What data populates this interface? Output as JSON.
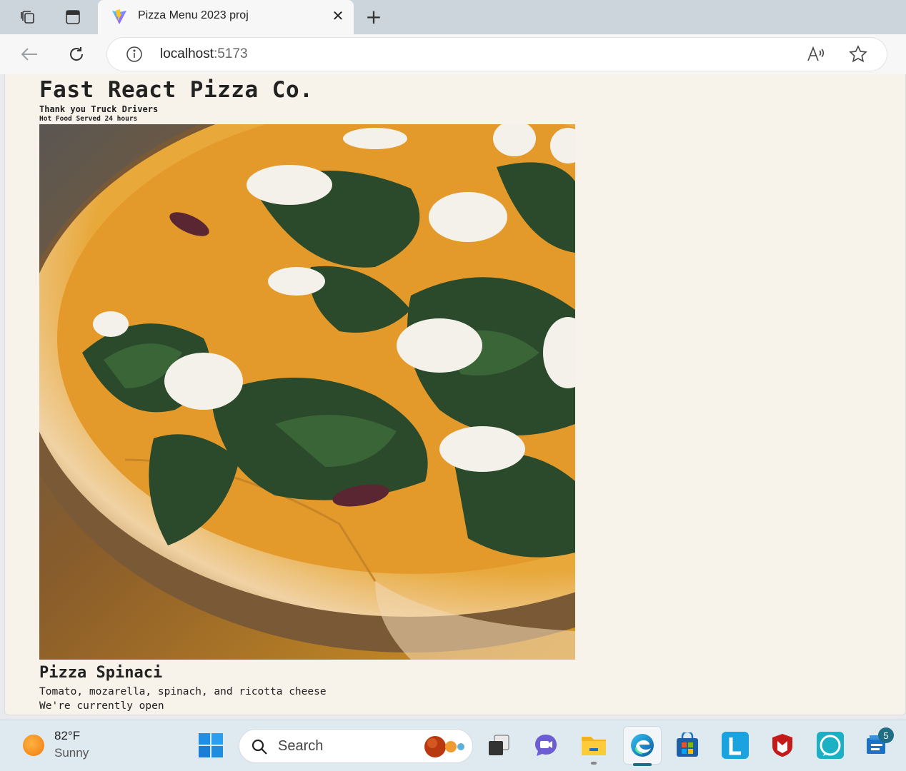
{
  "browser": {
    "tab_title": "Pizza Menu 2023 proj",
    "address_host": "localhost",
    "address_port": ":5173"
  },
  "page": {
    "title": "Fast React Pizza Co.",
    "subtitle": "Thank you Truck Drivers",
    "tagline": "Hot Food Served 24 hours",
    "pizza": {
      "name": "Pizza Spinaci",
      "ingredients": "Tomato, mozarella, spinach, and ricotta cheese",
      "status": "We're currently open",
      "photo_icon": "pizza-spinaci-photo"
    }
  },
  "taskbar": {
    "weather_temp": "82°F",
    "weather_condition": "Sunny",
    "search_placeholder": "Search",
    "notification_count": "5"
  },
  "colors": {
    "page_background": "#f7f2ea",
    "tabbar": "#cdd5dc",
    "taskbar": "#dfe9f0"
  }
}
